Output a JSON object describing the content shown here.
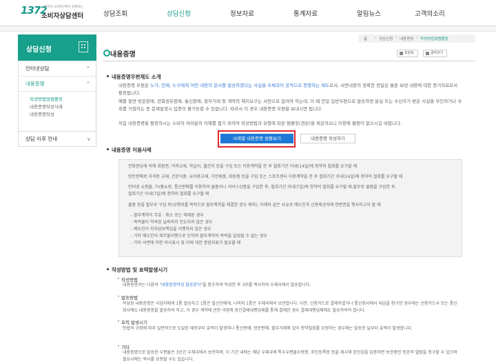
{
  "header": {
    "logo_num": "1372",
    "logo_tag": "정부와 소비자단체가 함께하는",
    "logo_name": "소비자상담센터",
    "nav": [
      "상담조회",
      "상담신청",
      "정보자료",
      "통계자료",
      "알림뉴스",
      "고객의소리"
    ],
    "active_nav": "상담신청"
  },
  "sidebar": {
    "title": "상담신청",
    "items": [
      {
        "label": "인터넷상담",
        "chevron": "^"
      },
      {
        "label": "내용증명",
        "chevron": "^",
        "active": true
      },
      {
        "label": "상담 이후 안내",
        "chevron": "v"
      }
    ],
    "sub_items": [
      "작성방법및템플릿",
      "내용증명작성사례",
      "내용증명작성"
    ],
    "active_sub": "작성방법및템플릿"
  },
  "breadcrumb": [
    "홈",
    "상담신청",
    "내용증명",
    "작성방법및템플릿"
  ],
  "page": {
    "title": "내용증명",
    "print_label": "프린트",
    "font_label": "글자크기"
  },
  "section1": {
    "heading": "내용증명우편제도 소개",
    "p1_a": "내용증명 우편은 ",
    "p1_hl": "누가, 언제, 누구에게 어떤 내용의 문서를 발송하였다는 사실을 우체국이 공적으로 증명하는 제도",
    "p1_b": "로서, 서면내용의 정확한 전달은 물론 보낸 내용에 대한 증거자료로서 활용됩니다.",
    "p2": "예를 들면 방문판매, 전화권유판매, 통신판매, 할부거래 등 계약의 해지요구는 서면으로 알려야 하는데, 이 때 만일 일반우편으로 발송하면 분실 또는 수신자가 받은 사실을 부인하거나 수취를 거절하는 등 문제발생시 입증이 불가능할 수 있습니다. 따라서 이 경우 내용증명 우편을 보내시면 됩니다.",
    "p3": "처음 내용증명을 활용하시는 소비자 여러분의 이해를 돕기 위하여 작성방법과 유형에 따른 템플릿(견본)을 제공하오니 이용에 불편이 없으시길 바랍니다.",
    "btn_primary": "사례별 내용증명 샘플보기",
    "btn_secondary": "내용증명 작성하기"
  },
  "section2": {
    "heading": "내용증명 이용사례",
    "bullets": [
      "전화권유에 의해 회원권, 어학교재, 학습지, 월간지 등을 구입 또는 이용계약을 한 후 철회기간 이내(14일)에 청약의 철회를 요구할 때",
      "방문판매로 자격증 교재, 건강식품, 유아용교재, 가전제품, 화장품 등을 구입 또는 스포츠센터 이용계약을 한 후 철회기간 이내(14일)에 청약의 철회를 요구할 때",
      "인터넷 쇼핑몰, TV홈쇼핑, 통신판매를 이용하여 물품이나 서비스상품을 구입한 후, 철회기간 이내(7일)에 청약의 철회를 요구할 때,할부로 물품을 구입한 후,",
      "철회기간 이내(7일)에 청약의 철회를 요구할 때",
      "물품 등을 할부로 구입 후(상행위를 목적으로 할부계약을 체결한 경우 제외), 아래와 같은 사유로 매도인과 신용제공자에 항변권을 행사하고자 할 때"
    ],
    "dashes": [
      "- 할부계약이 무효 · 취소 또는 해제된 경우",
      "- 목적물이 약속된 날짜까지 인도되지 않은 경우",
      "- 매도인이 하자담보책임을 이행하지 않은 경우",
      "- 기타 매도인의 채무불이행으로 인하여 할부계약의 목적을 달성할 수 없는 경우",
      "- 기타 서면에 의한 의사표시 및 이에 대한 증빙자료가 필요할 때"
    ]
  },
  "section3": {
    "heading": "작성방법 및 효력발생시기",
    "items": [
      {
        "title": "작성방법",
        "text_a": "내용증명서는 다음의 \"",
        "text_hl": "내용증명작성 발송양식",
        "text_b": "\"을 참조하여 작성한 후 3부를 복사하여 우체국에서 발송합니다."
      },
      {
        "title": "발송방법",
        "text": "작성된 내용증명은 사업자에게 1통 발송하고 1통은 발신인에게, 나머지 1통은 우체국에서 보관합니다. 다만, 신용카드로 결제하였거나 통신회사에서 대금을 청구한 경우에는 신용카드사 또는 통신회사에도 내용증명을 발송하여 하고, 이 경우 계약에 관한 과정에 증간결제대행업체를 통해 결제한 경우 결제대행업체에도 발송하여야 합니다."
      },
      {
        "title": "효력 발생시기",
        "text": "민법의 규정에 따라 일반적으로 도달된 때로부터 효력이 발생하나 통신판매, 방문판매, 할부거래에 있어 청약철회를 요청하는 경우에는 발송한 날부터 효력이 발생합니다."
      },
      {
        "title": "기타",
        "text": "내용증명으로 발송한 우편물은 3년간 우체국에서 보관하며, 이 기간 내에는 해당 우체국에 특수우편물수령증, 주민등록증 등을 제시해 본인임을 입증하면 보관중인 등본의 열람을 청구할 수 있으며 필요시에는 복사를 요청할 수도 있습니다."
      }
    ]
  },
  "colors": {
    "brand": "#17a08c",
    "button": "#1e79d6",
    "highlight": "#e0252a",
    "link": "#3a7bd5"
  }
}
